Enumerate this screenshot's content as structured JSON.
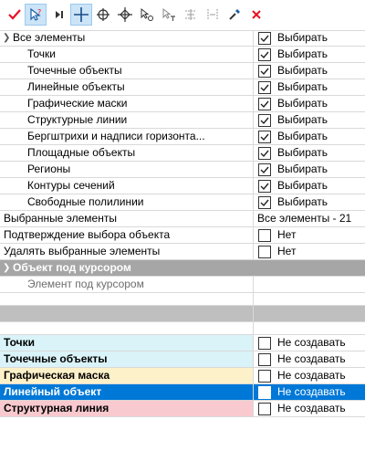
{
  "colors": {
    "accent": "#0078d7",
    "category_bg": "#a6a6a6",
    "row_cyan": "#d9f3f8",
    "row_yellow": "#fdf1c9",
    "row_pink": "#f8c9ce",
    "icon_red": "#e81123"
  },
  "toolbar": {
    "icons": [
      "check-icon",
      "select-pointer-icon",
      "next-icon",
      "crosshair-icon",
      "target-plus-icon",
      "target-diamond-icon",
      "select-node-icon",
      "select-text-icon",
      "select-area-icon",
      "select-distance-icon",
      "eyedropper-icon",
      "close-icon"
    ]
  },
  "tree": {
    "all_elements": {
      "label": "Все элементы",
      "value": "Выбирать",
      "checked": true
    },
    "children": [
      {
        "label": "Точки",
        "value": "Выбирать",
        "checked": true
      },
      {
        "label": "Точечные объекты",
        "value": "Выбирать",
        "checked": true
      },
      {
        "label": "Линейные объекты",
        "value": "Выбирать",
        "checked": true
      },
      {
        "label": "Графические маски",
        "value": "Выбирать",
        "checked": true
      },
      {
        "label": "Структурные линии",
        "value": "Выбирать",
        "checked": true
      },
      {
        "label": "Бергштрихи и надписи горизонта...",
        "value": "Выбирать",
        "checked": true
      },
      {
        "label": "Площадные объекты",
        "value": "Выбирать",
        "checked": true
      },
      {
        "label": "Регионы",
        "value": "Выбирать",
        "checked": true
      },
      {
        "label": "Контуры сечений",
        "value": "Выбирать",
        "checked": true
      },
      {
        "label": "Свободные полилинии",
        "value": "Выбирать",
        "checked": true
      }
    ]
  },
  "properties": {
    "selected_elements": {
      "label": "Выбранные элементы",
      "value": "Все элементы - 21"
    },
    "confirm_selection": {
      "label": "Подтверждение выбора объекта",
      "value": "Нет",
      "checked": false
    },
    "delete_selected": {
      "label": "Удалять выбранные элементы",
      "value": "Нет",
      "checked": false
    }
  },
  "category": {
    "label": "Объект под курсором",
    "element_label": "Элемент под курсором"
  },
  "create_rows": [
    {
      "label": "Точки",
      "value": "Не создавать",
      "checked": false
    },
    {
      "label": "Точечные объекты",
      "value": "Не создавать",
      "checked": false
    },
    {
      "label": "Графическая маска",
      "value": "Не создавать",
      "checked": false
    },
    {
      "label": "Линейный объект",
      "value": "Не создавать",
      "checked": false
    },
    {
      "label": "Структурная линия",
      "value": "Не создавать",
      "checked": false
    }
  ]
}
